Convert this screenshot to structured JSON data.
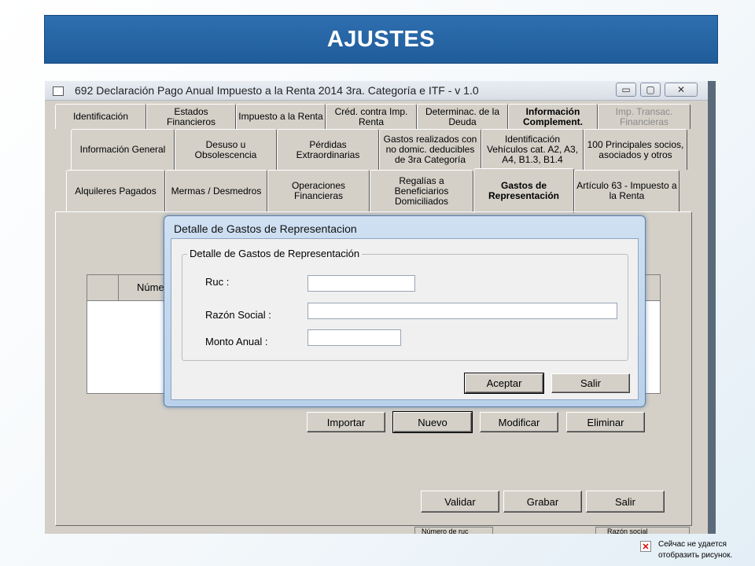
{
  "slide": {
    "title": "AJUSTES"
  },
  "window": {
    "title": "692 Declaración Pago Anual Impuesto a la Renta 2014 3ra. Categoría e ITF - v 1.0",
    "min": "▭",
    "max": "▢",
    "close": "✕"
  },
  "tabs_row1": [
    {
      "text": "Identificación"
    },
    {
      "text": "Estados Financieros"
    },
    {
      "text": "Impuesto a la Renta"
    },
    {
      "text": "Créd. contra Imp. Renta"
    },
    {
      "text": "Determinac. de la Deuda"
    },
    {
      "text": "Información Complement."
    },
    {
      "text": "Imp. Transac. Financieras"
    }
  ],
  "tabs_row2": [
    {
      "text": "Información General"
    },
    {
      "text": "Desuso u Obsolescencia"
    },
    {
      "text": "Pérdidas Extraordinarias"
    },
    {
      "text": "Gastos realizados con no domic. deducibles de 3ra Categoría"
    },
    {
      "text": "Identificación Vehículos cat. A2, A3, A4, B1.3, B1.4"
    },
    {
      "text": "100 Principales socios, asociados y otros"
    }
  ],
  "tabs_row3": [
    {
      "text": "Alquileres Pagados"
    },
    {
      "text": "Mermas / Desmedros"
    },
    {
      "text": "Operaciones Financieras"
    },
    {
      "text": "Regalías a Beneficiarios Domiciliados"
    },
    {
      "text": "Gastos de Representación"
    },
    {
      "text": "Artículo 63 - Impuesto a la Renta"
    }
  ],
  "grid": {
    "col_numero": "Núme"
  },
  "actions": {
    "importar": "Importar",
    "nuevo": "Nuevo",
    "modificar": "Modificar",
    "eliminar": "Eliminar"
  },
  "footer_buttons": {
    "validar": "Validar",
    "grabar": "Grabar",
    "salir": "Salir"
  },
  "bottom_strip": {
    "numero": "Número de ruc",
    "razon": "Razón social"
  },
  "dialog": {
    "title": "Detalle de Gastos de Representacion",
    "group": "Detalle de Gastos de Representación",
    "ruc_label": "Ruc :",
    "ruc_value": "",
    "razon_label": "Razón Social :",
    "razon_value": "",
    "monto_label": "Monto Anual :",
    "monto_value": "",
    "aceptar": "Aceptar",
    "salir": "Salir"
  },
  "error_box": {
    "line1": "Сейчас не удается",
    "line2": "отобразить рисунок."
  }
}
